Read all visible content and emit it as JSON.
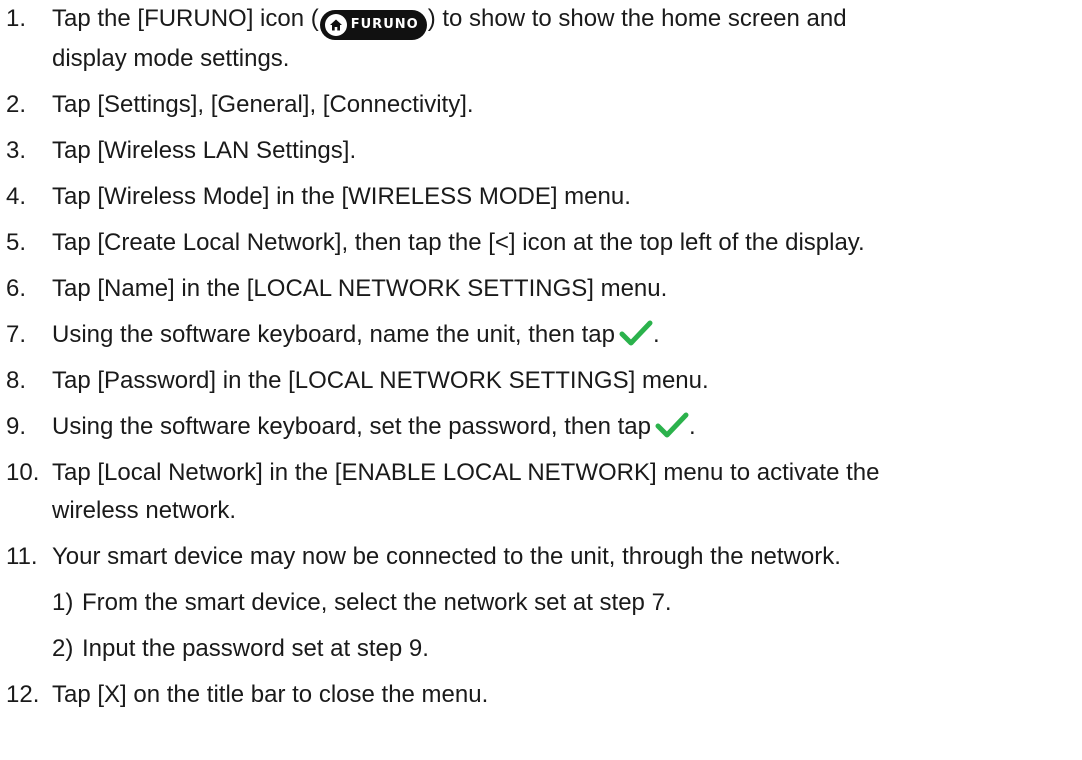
{
  "steps": [
    {
      "number": "1.",
      "before": "Tap the [FURUNO] icon (",
      "icon_brand": "FURUNO",
      "after": ") to show to show the home screen and",
      "line2": "display mode settings."
    },
    {
      "number": "2.",
      "text": "Tap [Settings], [General], [Connectivity]."
    },
    {
      "number": "3.",
      "text": "Tap [Wireless LAN Settings]."
    },
    {
      "number": "4.",
      "text": "Tap [Wireless Mode] in the [WIRELESS MODE] menu."
    },
    {
      "number": "5.",
      "text": "Tap [Create Local Network], then tap the [<] icon at the top left of the display."
    },
    {
      "number": "6.",
      "text": "Tap [Name] in the [LOCAL NETWORK SETTINGS] menu."
    },
    {
      "number": "7.",
      "before": "Using the software keyboard, name the unit, then tap",
      "after": "."
    },
    {
      "number": "8.",
      "text": "Tap [Password] in the [LOCAL NETWORK SETTINGS] menu."
    },
    {
      "number": "9.",
      "before": "Using the software keyboard, set the password, then tap",
      "after": "."
    },
    {
      "number": "10.",
      "text": "Tap [Local Network] in the [ENABLE LOCAL NETWORK] menu to activate the",
      "line2": "wireless network."
    },
    {
      "number": "11.",
      "text": "Your smart device may now be connected to the unit, through the network.",
      "substeps": [
        {
          "number": "1)",
          "text": "From the smart device, select the network set at step 7."
        },
        {
          "number": "2)",
          "text": "Input the password set at step 9."
        }
      ]
    },
    {
      "number": "12.",
      "text": "Tap [X] on the title bar to close the menu."
    }
  ],
  "colors": {
    "text": "#1a1a1a",
    "badge_bg": "#111111",
    "check": "#2bb24c"
  },
  "icons": {
    "furuno": "home-icon",
    "confirm": "check-icon"
  }
}
